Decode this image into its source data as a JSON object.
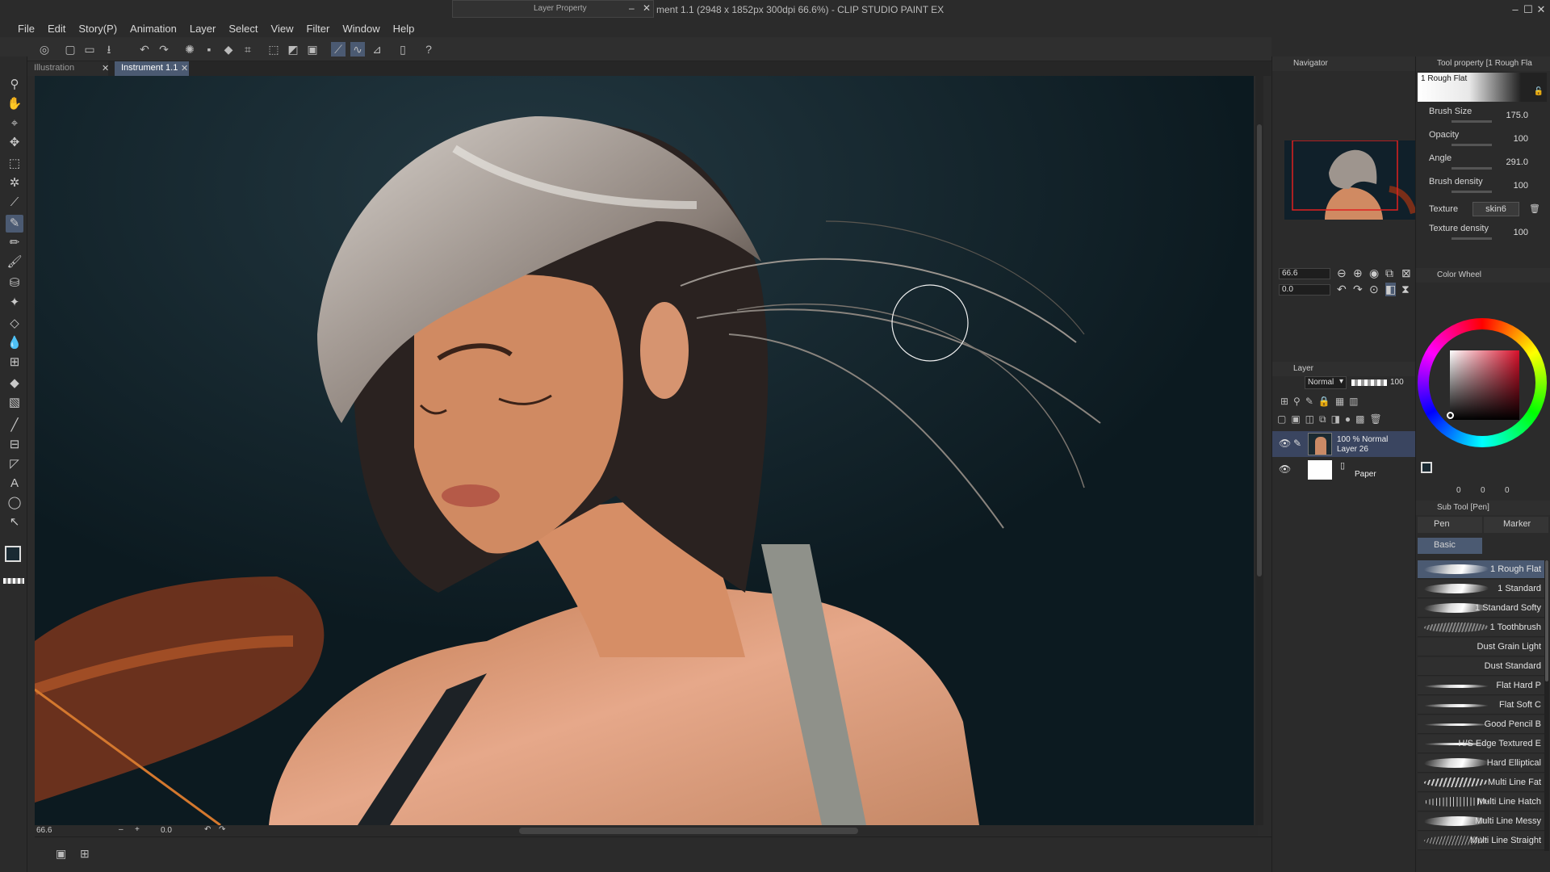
{
  "app": {
    "title": "ment 1.1 (2948 x 1852px 300dpi 66.6%) - CLIP STUDIO PAINT EX",
    "floating_window_title": "Layer Property"
  },
  "menu": [
    "File",
    "Edit",
    "Story(P)",
    "Animation",
    "Layer",
    "Select",
    "View",
    "Filter",
    "Window",
    "Help"
  ],
  "tabs": [
    {
      "label": "Illustration",
      "active": false
    },
    {
      "label": "Instrument 1.1",
      "active": true
    }
  ],
  "canvas_status": {
    "zoom": "66.6",
    "rotation": "0.0"
  },
  "navigator": {
    "title": "Navigator",
    "zoom": "66.6",
    "rotation": "0.0"
  },
  "layer_panel": {
    "title": "Layer",
    "blend_mode": "Normal",
    "opacity": "100",
    "layers": [
      {
        "info": "100 % Normal",
        "name": "Layer 26",
        "selected": true
      },
      {
        "info": "",
        "name": "Paper",
        "selected": false
      }
    ]
  },
  "tool_property": {
    "title": "Tool property [1 Rough Fla",
    "brush_preview_name": "1 Rough Flat",
    "rows": [
      {
        "label": "Brush Size",
        "value": "175.0"
      },
      {
        "label": "Opacity",
        "value": "100"
      },
      {
        "label": "Angle",
        "value": "291.0"
      },
      {
        "label": "Brush density",
        "value": "100"
      },
      {
        "label": "Texture",
        "value": "skin6"
      },
      {
        "label": "Texture density",
        "value": "100"
      }
    ]
  },
  "color_wheel": {
    "title": "Color Wheel",
    "values": [
      "0",
      "0",
      "0"
    ],
    "main_color": "#1a2a33",
    "hue_color": "#d8102a"
  },
  "sub_tool": {
    "title": "Sub Tool [Pen]",
    "tabs": [
      "Pen",
      "Marker"
    ],
    "group": "Basic",
    "brushes": [
      {
        "name": "1 Rough Flat",
        "active": true
      },
      {
        "name": "1 Standard",
        "active": false
      },
      {
        "name": "1 Standard Softy",
        "active": false
      },
      {
        "name": "1 Toothbrush",
        "active": false
      },
      {
        "name": "Dust Grain Light",
        "active": false
      },
      {
        "name": "Dust Standard",
        "active": false
      },
      {
        "name": "Flat Hard P",
        "active": false
      },
      {
        "name": "Flat Soft C",
        "active": false
      },
      {
        "name": "Good Pencil B",
        "active": false
      },
      {
        "name": "H/S Edge Textured E",
        "active": false
      },
      {
        "name": "Hard Elliptical",
        "active": false
      },
      {
        "name": "Multi Line Fat",
        "active": false
      },
      {
        "name": "Multi Line Hatch",
        "active": false
      },
      {
        "name": "Multi Line Messy",
        "active": false
      },
      {
        "name": "Multi Line Straight",
        "active": false
      }
    ]
  },
  "colors": {
    "accent": "#4b5a72",
    "canvas_bg": "#0f1e24",
    "skin": "#d38a5c",
    "hair": "#b8b0a8"
  }
}
